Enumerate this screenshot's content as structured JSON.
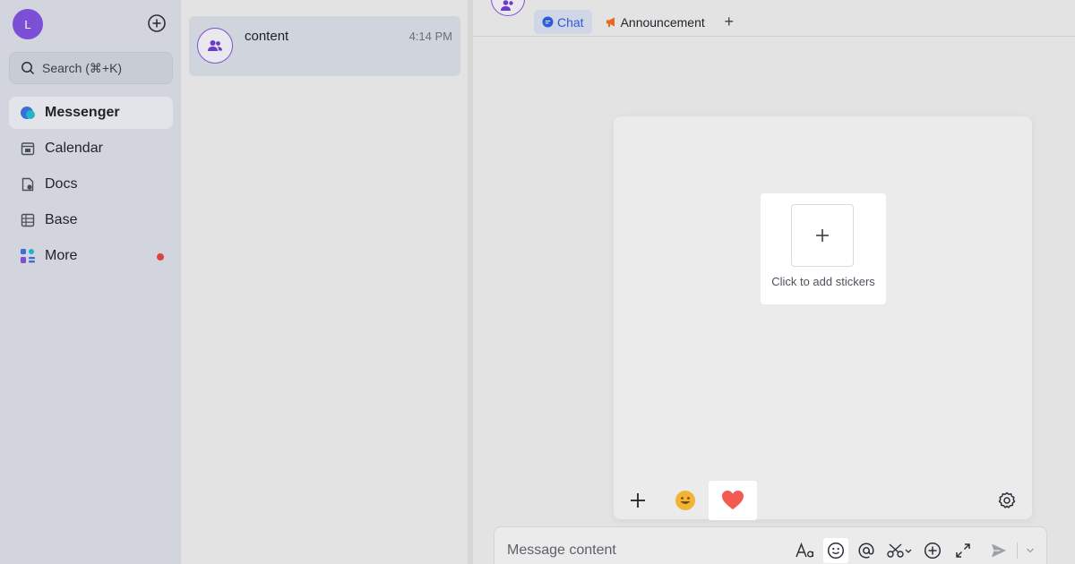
{
  "sidebar": {
    "avatar_initial": "L",
    "search_placeholder": "Search (⌘+K)",
    "items": [
      {
        "label": "Messenger",
        "icon": "messenger-icon",
        "active": true
      },
      {
        "label": "Calendar",
        "icon": "calendar-icon"
      },
      {
        "label": "Docs",
        "icon": "docs-icon"
      },
      {
        "label": "Base",
        "icon": "base-icon"
      },
      {
        "label": "More",
        "icon": "more-apps-icon",
        "badge": "dot"
      }
    ]
  },
  "chat_list": {
    "items": [
      {
        "name": "content",
        "time": "4:14 PM",
        "icon": "group-icon"
      }
    ]
  },
  "conversation": {
    "tabs": [
      {
        "label": "Chat",
        "icon": "chat-bubble-icon",
        "active": true
      },
      {
        "label": "Announcement",
        "icon": "megaphone-icon"
      }
    ],
    "tab_add": "+",
    "sticker_panel": {
      "add_label": "Click to add stickers",
      "tools": [
        "add-icon",
        "emoji-icon",
        "heart-icon",
        "settings-icon"
      ]
    },
    "input": {
      "placeholder": "Message content",
      "tools": [
        "text-format-icon",
        "emoji-icon",
        "mention-icon",
        "screenshot-icon",
        "add-circle-icon",
        "expand-icon",
        "send-icon",
        "chevron-down-icon"
      ]
    }
  },
  "colors": {
    "accent_purple": "#7b4fd6",
    "tab_active_blue": "#2f5bd8",
    "badge_red": "#d9463b",
    "heart_red": "#f25a52"
  }
}
